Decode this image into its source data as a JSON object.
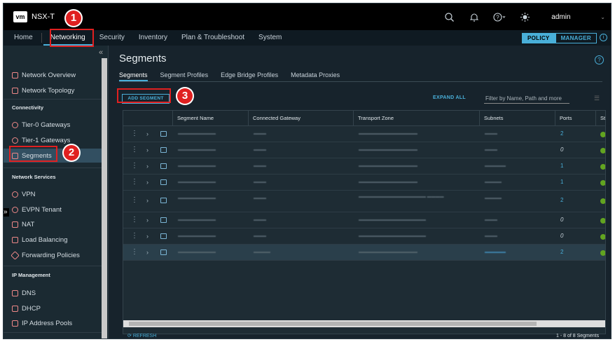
{
  "header": {
    "logo": "vm",
    "app_title": "NSX-T",
    "user": "admin"
  },
  "nav": {
    "items": [
      "Home",
      "Networking",
      "Security",
      "Inventory",
      "Plan & Troubleshoot",
      "System"
    ],
    "active": "Networking",
    "mode": {
      "policy": "POLICY",
      "manager": "MANAGER"
    }
  },
  "sidebar": {
    "top": [
      "Network Overview",
      "Network Topology"
    ],
    "connectivity": {
      "title": "Connectivity",
      "items": [
        "Tier-0 Gateways",
        "Tier-1 Gateways",
        "Segments"
      ]
    },
    "network_services": {
      "title": "Network Services",
      "items": [
        "VPN",
        "EVPN Tenant",
        "NAT",
        "Load Balancing",
        "Forwarding Policies"
      ]
    },
    "ip_management": {
      "title": "IP Management",
      "items": [
        "DNS",
        "DHCP",
        "IP Address Pools"
      ]
    },
    "selected": "Segments"
  },
  "page": {
    "title": "Segments",
    "tabs": [
      "Segments",
      "Segment Profiles",
      "Edge Bridge Profiles",
      "Metadata Proxies"
    ],
    "active_tab": "Segments"
  },
  "toolbar": {
    "add_segment": "ADD SEGMENT",
    "expand_all": "EXPAND ALL",
    "filter_placeholder": "Filter by Name, Path and more"
  },
  "table": {
    "columns": [
      "Segment Name",
      "Connected Gateway",
      "Transport Zone",
      "Subnets",
      "Ports",
      "St"
    ],
    "ports": [
      "2",
      "0",
      "1",
      "1",
      "2",
      "0",
      "0",
      "2"
    ]
  },
  "footer": {
    "refresh": "REFRESH",
    "count": "1 - 8 of 8 Segments"
  },
  "callouts": [
    "1",
    "2",
    "3"
  ],
  "colors": {
    "accent": "#49afd9",
    "callout": "#e02020",
    "status_ok": "#62a420"
  }
}
